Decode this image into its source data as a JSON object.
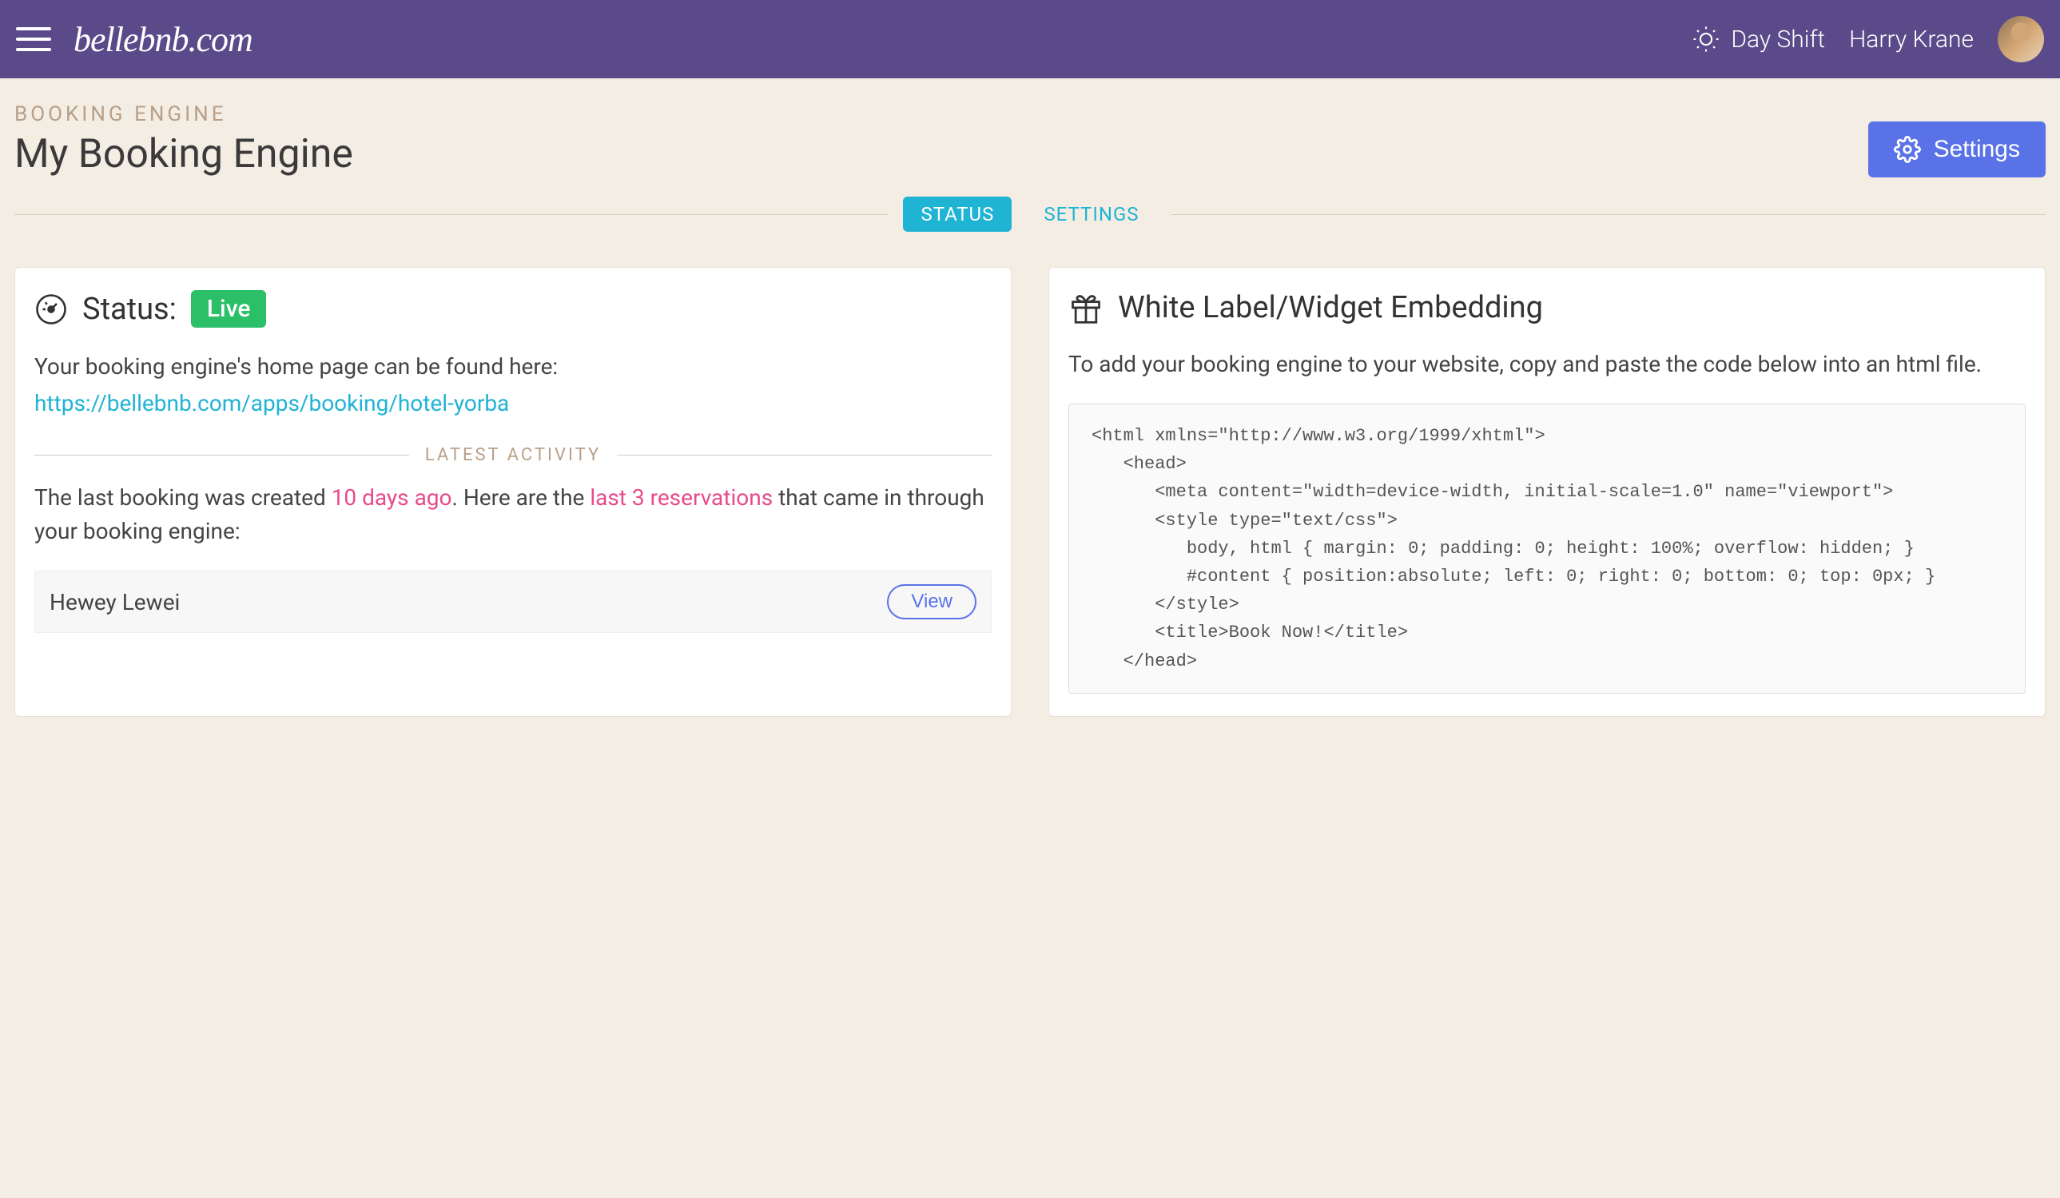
{
  "navbar": {
    "logo": "bellebnb.com",
    "day_shift": "Day Shift",
    "user_name": "Harry Krane"
  },
  "header": {
    "breadcrumb": "BOOKING ENGINE",
    "title": "My Booking Engine",
    "settings_button": "Settings"
  },
  "tabs": {
    "status": "STATUS",
    "settings": "SETTINGS"
  },
  "status_card": {
    "title": "Status:",
    "badge": "Live",
    "intro_text": "Your booking engine's home page can be found here:",
    "url": "https://bellebnb.com/apps/booking/hotel-yorba",
    "activity_label": "LATEST ACTIVITY",
    "activity_prefix": "The last booking was created ",
    "activity_days": "10 days ago",
    "activity_mid": ". Here are the ",
    "activity_count": "last 3 reservations",
    "activity_suffix": " that came in through your booking engine:",
    "reservations": [
      {
        "name": "Hewey Lewei",
        "view_label": "View"
      }
    ]
  },
  "widget_card": {
    "title": "White Label/Widget Embedding",
    "intro_text": "To add your booking engine to your website, copy and paste the code below into an html file.",
    "code": "<html xmlns=\"http://www.w3.org/1999/xhtml\">\n   <head>\n      <meta content=\"width=device-width, initial-scale=1.0\" name=\"viewport\">\n      <style type=\"text/css\">\n         body, html { margin: 0; padding: 0; height: 100%; overflow: hidden; }\n         #content { position:absolute; left: 0; right: 0; bottom: 0; top: 0px; }\n      </style>\n      <title>Book Now!</title>\n   </head>"
  }
}
